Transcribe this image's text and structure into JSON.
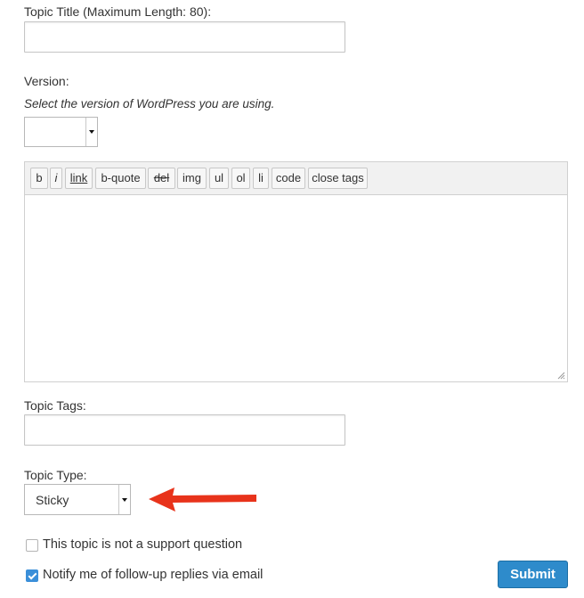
{
  "topic_title": {
    "label": "Topic Title (Maximum Length: 80):",
    "value": ""
  },
  "version": {
    "label": "Version:",
    "hint": "Select the version of WordPress you are using.",
    "selected": ""
  },
  "editor": {
    "buttons": [
      "b",
      "i",
      "link",
      "b-quote",
      "del",
      "img",
      "ul",
      "ol",
      "li",
      "code",
      "close tags"
    ],
    "content": ""
  },
  "topic_tags": {
    "label": "Topic Tags:",
    "value": ""
  },
  "topic_type": {
    "label": "Topic Type:",
    "selected": "Sticky"
  },
  "options": {
    "not_support": {
      "label": "This topic is not a support question",
      "checked": false
    },
    "notify": {
      "label": "Notify me of follow-up replies via email",
      "checked": true
    }
  },
  "submit_label": "Submit",
  "colors": {
    "arrow": "#e8331b",
    "submit_bg": "#2e8bcb",
    "checkbox_checked": "#3b8fd9"
  },
  "icons": [
    "dropdown-caret-icon",
    "resize-grip-icon",
    "red-arrow-icon",
    "checkmark-icon"
  ]
}
